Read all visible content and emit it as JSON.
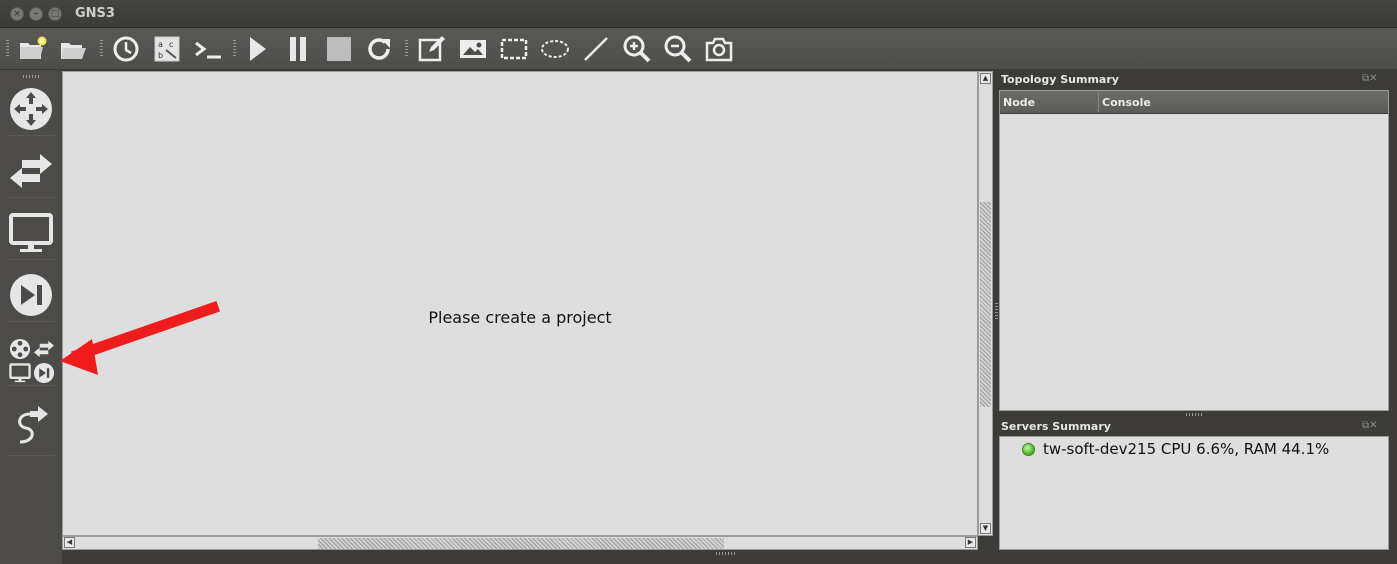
{
  "window": {
    "title": "GNS3"
  },
  "toolbar": {
    "buttons": [
      "new-project",
      "open-project",
      "snapshots",
      "show-interface-labels",
      "console-all",
      "start-all",
      "suspend-all",
      "stop-all",
      "reload-all",
      "add-note",
      "insert-image",
      "draw-rectangle",
      "draw-ellipse",
      "draw-line",
      "zoom-in",
      "zoom-out",
      "screenshot"
    ]
  },
  "dock": {
    "devices": [
      "routers",
      "switches",
      "end-devices",
      "security-devices",
      "all-devices",
      "add-link"
    ]
  },
  "canvas": {
    "message": "Please create a project"
  },
  "topology": {
    "title": "Topology Summary",
    "columns": [
      "Node",
      "Console"
    ],
    "rows": []
  },
  "servers": {
    "title": "Servers Summary",
    "entries": [
      {
        "text": "tw-soft-dev215 CPU 6.6%, RAM 44.1%",
        "status_color": "#4fbf2a"
      }
    ]
  },
  "colors": {
    "annotation_arrow": "#ee1c1c",
    "canvas_bg": "#dedede"
  }
}
